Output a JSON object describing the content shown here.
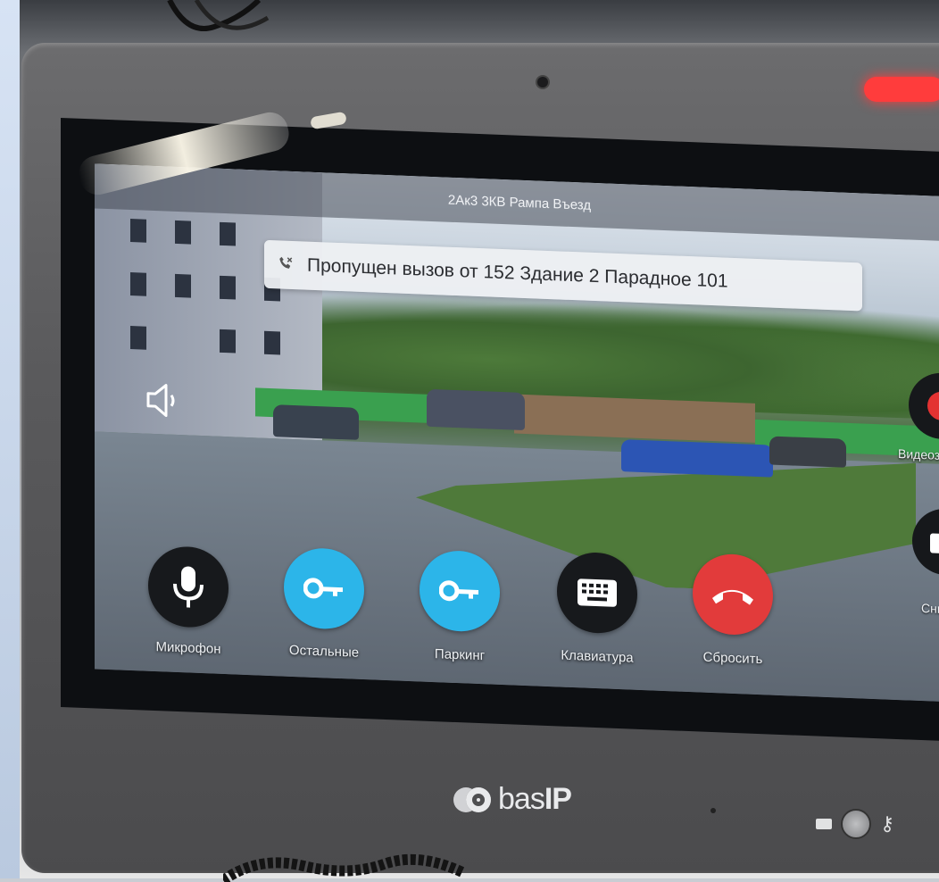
{
  "topbar": {
    "title": "2Ак3 3КВ Рампа Въезд"
  },
  "notification": {
    "icon": "missed-call-icon",
    "text": "Пропущен вызов от  152 Здание 2 Парадное 101"
  },
  "side_controls": {
    "record_label": "Видеозап",
    "snapshot_label": "Снимо"
  },
  "controls": [
    {
      "id": "microphone",
      "label": "Микрофон",
      "icon": "microphone-icon",
      "color": "#17191c"
    },
    {
      "id": "others",
      "label": "Остальные",
      "icon": "key-icon",
      "color": "#2cb5e9"
    },
    {
      "id": "parking",
      "label": "Паркинг",
      "icon": "key-icon",
      "color": "#2cb5e9"
    },
    {
      "id": "keyboard",
      "label": "Клавиатура",
      "icon": "keyboard-icon",
      "color": "#17191c"
    },
    {
      "id": "hangup",
      "label": "Сбросить",
      "icon": "hangup-icon",
      "color": "#e23b3b"
    }
  ],
  "device": {
    "brand": "bas",
    "brand_suffix": "IP",
    "led_color": "#ff3c3c"
  }
}
